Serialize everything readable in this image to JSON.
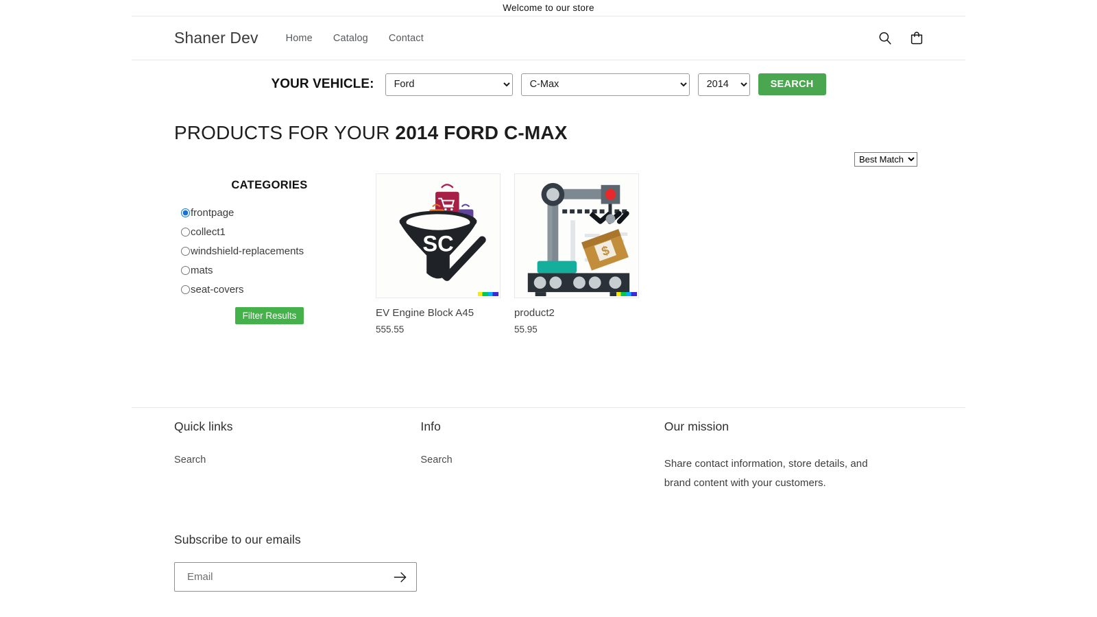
{
  "announcement": {
    "text": "Welcome to our store"
  },
  "header": {
    "brand": "Shaner Dev",
    "nav": [
      {
        "label": "Home"
      },
      {
        "label": "Catalog"
      },
      {
        "label": "Contact"
      }
    ],
    "icons": {
      "search": "search-icon",
      "cart": "cart-icon"
    }
  },
  "vehicle_bar": {
    "label": "YOUR VEHICLE:",
    "make": {
      "selected": "Ford",
      "options": [
        "Ford"
      ]
    },
    "model": {
      "selected": "C-Max",
      "options": [
        "C-Max"
      ]
    },
    "year": {
      "selected": "2014",
      "options": [
        "2014"
      ]
    },
    "search_button": "SEARCH",
    "button_color": "#4aa64f"
  },
  "results": {
    "title_prefix": "PRODUCTS FOR YOUR ",
    "title_vehicle": "2014 FORD C-MAX",
    "sort": {
      "selected": "Best Match",
      "options": [
        "Best Match"
      ]
    }
  },
  "sidebar": {
    "title": "CATEGORIES",
    "categories": [
      {
        "label": "frontpage",
        "selected": true
      },
      {
        "label": "collect1",
        "selected": false
      },
      {
        "label": "windshield-replacements",
        "selected": false
      },
      {
        "label": "mats",
        "selected": false
      },
      {
        "label": "seat-covers",
        "selected": false
      }
    ],
    "filter_button": "Filter Results",
    "filter_button_color": "#45b14b"
  },
  "products": [
    {
      "title": "EV Engine Block A45",
      "price": "555.55",
      "image": "sc-funnel-logo"
    },
    {
      "title": "product2",
      "price": "55.95",
      "image": "robotic-arm-conveyor"
    }
  ],
  "footer": {
    "columns": [
      {
        "heading": "Quick links",
        "links": [
          {
            "label": "Search"
          }
        ]
      },
      {
        "heading": "Info",
        "links": [
          {
            "label": "Search"
          }
        ]
      }
    ],
    "mission": {
      "heading": "Our mission",
      "text": "Share contact information, store details, and brand content with your customers."
    },
    "subscribe": {
      "heading": "Subscribe to our emails",
      "placeholder": "Email",
      "value": "",
      "submit_icon": "arrow-right-icon"
    }
  }
}
